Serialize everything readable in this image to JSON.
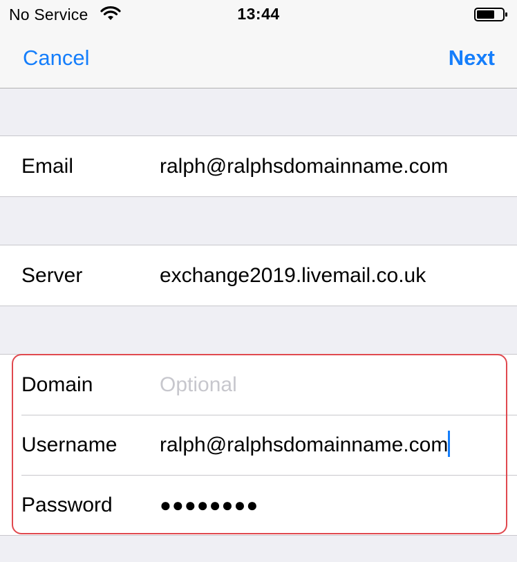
{
  "status_bar": {
    "carrier": "No Service",
    "time": "13:44",
    "wifi_icon": "wifi-icon",
    "battery_icon": "battery-icon"
  },
  "nav": {
    "cancel_label": "Cancel",
    "next_label": "Next"
  },
  "account": {
    "email_label": "Email",
    "email_value": "ralph@ralphsdomainname.com"
  },
  "server": {
    "server_label": "Server",
    "server_value": "exchange2019.livemail.co.uk"
  },
  "credentials": {
    "domain_label": "Domain",
    "domain_placeholder": "Optional",
    "username_label": "Username",
    "username_value": "ralph@ralphsdomainname.com",
    "password_label": "Password",
    "password_value": "●●●●●●●●"
  },
  "colors": {
    "accent": "#157efb",
    "highlight": "#e0484e",
    "background": "#efeff4"
  }
}
